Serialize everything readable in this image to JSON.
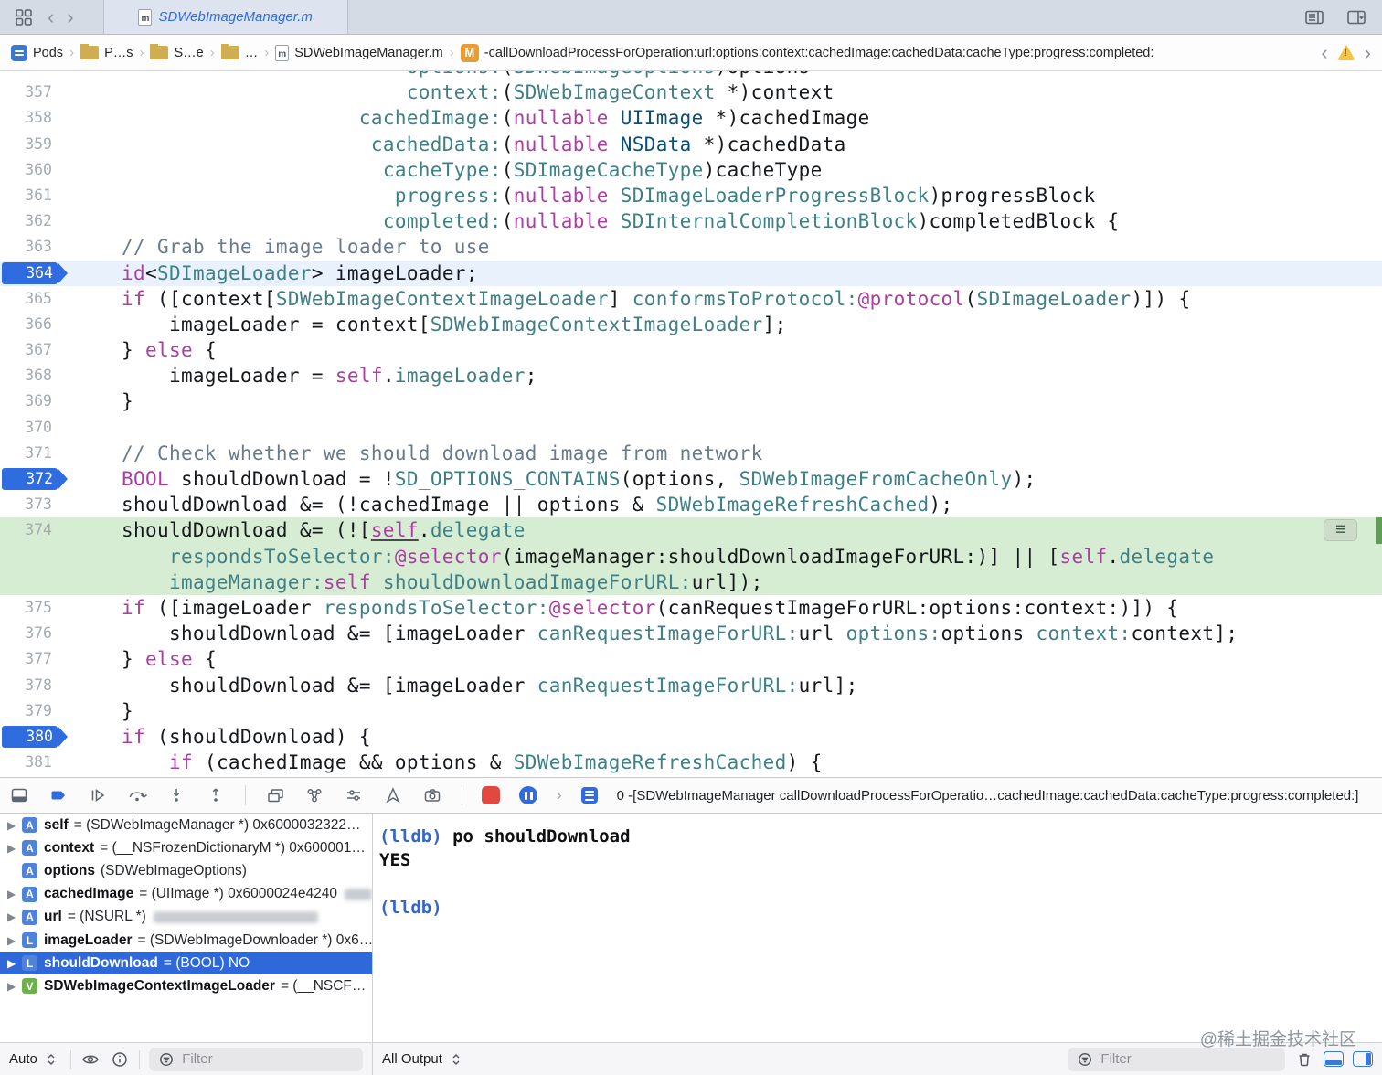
{
  "window": {
    "tab_title": "SDWebImageManager.m"
  },
  "jumpbar": {
    "items": [
      "Pods",
      "P…s",
      "S…e",
      "…",
      "SDWebImageManager.m"
    ],
    "method": "-callDownloadProcessForOperation:url:options:context:cachedImage:cachedData:cacheType:progress:completed:"
  },
  "colors": {
    "breakpoint_blue": "#2e6ce0",
    "selection_blue": "#2f68d8",
    "exec_green_bg": "#d7edd3",
    "keyword_pink": "#ad3da4",
    "project_teal": "#3e8087",
    "system_blue": "#0b4f79",
    "comment_gray": "#697b8a"
  },
  "icons": {
    "tabbar": [
      "tab-overview-icon",
      "back-chevron-icon",
      "forward-chevron-icon",
      "objc-file-icon",
      "editor-options-icon",
      "add-editor-icon"
    ],
    "jumpbar": [
      "project-icon",
      "folder-icon",
      "objc-file-icon",
      "method-badge-icon",
      "back-chevron-icon",
      "warning-icon",
      "forward-chevron-icon"
    ],
    "debugbar": [
      "hide-debug-area-icon",
      "breakpoints-toggle-icon",
      "continue-icon",
      "step-over-icon",
      "step-into-icon",
      "step-out-icon",
      "view-hierarchy-icon",
      "memory-graph-icon",
      "environment-overrides-icon",
      "simulate-location-icon",
      "metal-capture-icon",
      "app-icon",
      "paused-thread-icon",
      "stack-frame-icon"
    ],
    "bottombar": [
      "scope-chevrons-icon",
      "quicklook-eye-icon",
      "info-icon",
      "filter-icon",
      "trash-icon",
      "dock-bottom-icon",
      "dock-right-icon"
    ]
  },
  "editor": {
    "lines": [
      {
        "n": "",
        "k": "",
        "s": [
          [
            "p",
            "                            "
          ],
          [
            "t",
            "options:"
          ],
          [
            "p",
            "("
          ],
          [
            "t",
            "SDWebImageOptions"
          ],
          [
            "p",
            ")options"
          ]
        ]
      },
      {
        "n": "357",
        "k": "",
        "s": [
          [
            "p",
            "                            "
          ],
          [
            "t",
            "context:"
          ],
          [
            "p",
            "("
          ],
          [
            "t",
            "SDWebImageContext"
          ],
          [
            "p",
            " *)context"
          ]
        ]
      },
      {
        "n": "358",
        "k": "",
        "s": [
          [
            "p",
            "                        "
          ],
          [
            "t",
            "cachedImage:"
          ],
          [
            "p",
            "("
          ],
          [
            "k",
            "nullable"
          ],
          [
            "p",
            " "
          ],
          [
            "s",
            "UIImage"
          ],
          [
            "p",
            " *)cachedImage"
          ]
        ]
      },
      {
        "n": "359",
        "k": "",
        "s": [
          [
            "p",
            "                         "
          ],
          [
            "t",
            "cachedData:"
          ],
          [
            "p",
            "("
          ],
          [
            "k",
            "nullable"
          ],
          [
            "p",
            " "
          ],
          [
            "s",
            "NSData"
          ],
          [
            "p",
            " *)cachedData"
          ]
        ]
      },
      {
        "n": "360",
        "k": "",
        "s": [
          [
            "p",
            "                          "
          ],
          [
            "t",
            "cacheType:"
          ],
          [
            "p",
            "("
          ],
          [
            "t",
            "SDImageCacheType"
          ],
          [
            "p",
            ")cacheType"
          ]
        ]
      },
      {
        "n": "361",
        "k": "",
        "s": [
          [
            "p",
            "                           "
          ],
          [
            "t",
            "progress:"
          ],
          [
            "p",
            "("
          ],
          [
            "k",
            "nullable"
          ],
          [
            "p",
            " "
          ],
          [
            "t",
            "SDImageLoaderProgressBlock"
          ],
          [
            "p",
            ")progressBlock"
          ]
        ]
      },
      {
        "n": "362",
        "k": "",
        "s": [
          [
            "p",
            "                          "
          ],
          [
            "t",
            "completed:"
          ],
          [
            "p",
            "("
          ],
          [
            "k",
            "nullable"
          ],
          [
            "p",
            " "
          ],
          [
            "t",
            "SDInternalCompletionBlock"
          ],
          [
            "p",
            ")completedBlock {"
          ]
        ]
      },
      {
        "n": "363",
        "k": "",
        "s": [
          [
            "p",
            "    "
          ],
          [
            "c",
            "// Grab the image loader to use"
          ]
        ]
      },
      {
        "n": "364",
        "k": "bp",
        "bg": "sel",
        "s": [
          [
            "p",
            "    "
          ],
          [
            "k",
            "id"
          ],
          [
            "p",
            "<"
          ],
          [
            "t",
            "SDImageLoader"
          ],
          [
            "p",
            "> imageLoader;"
          ]
        ]
      },
      {
        "n": "365",
        "k": "",
        "s": [
          [
            "p",
            "    "
          ],
          [
            "k",
            "if"
          ],
          [
            "p",
            " ([context["
          ],
          [
            "t",
            "SDWebImageContextImageLoader"
          ],
          [
            "p",
            "] "
          ],
          [
            "t",
            "conformsToProtocol:"
          ],
          [
            "k",
            "@protocol"
          ],
          [
            "p",
            "("
          ],
          [
            "t",
            "SDImageLoader"
          ],
          [
            "p",
            ")]) {"
          ]
        ]
      },
      {
        "n": "366",
        "k": "",
        "s": [
          [
            "p",
            "        imageLoader = context["
          ],
          [
            "t",
            "SDWebImageContextImageLoader"
          ],
          [
            "p",
            "];"
          ]
        ]
      },
      {
        "n": "367",
        "k": "",
        "s": [
          [
            "p",
            "    } "
          ],
          [
            "k",
            "else"
          ],
          [
            "p",
            " {"
          ]
        ]
      },
      {
        "n": "368",
        "k": "",
        "s": [
          [
            "p",
            "        imageLoader = "
          ],
          [
            "k",
            "self"
          ],
          [
            "p",
            "."
          ],
          [
            "t",
            "imageLoader"
          ],
          [
            "p",
            ";"
          ]
        ]
      },
      {
        "n": "369",
        "k": "",
        "s": [
          [
            "p",
            "    }"
          ]
        ]
      },
      {
        "n": "370",
        "k": "",
        "s": []
      },
      {
        "n": "371",
        "k": "",
        "s": [
          [
            "p",
            "    "
          ],
          [
            "c",
            "// Check whether we should download image from network"
          ]
        ]
      },
      {
        "n": "372",
        "k": "bp",
        "s": [
          [
            "p",
            "    "
          ],
          [
            "k",
            "BOOL"
          ],
          [
            "p",
            " shouldDownload = !"
          ],
          [
            "t",
            "SD_OPTIONS_CONTAINS"
          ],
          [
            "p",
            "(options, "
          ],
          [
            "t",
            "SDWebImageFromCacheOnly"
          ],
          [
            "p",
            ");"
          ]
        ]
      },
      {
        "n": "373",
        "k": "",
        "s": [
          [
            "p",
            "    shouldDownload &= (!cachedImage || options & "
          ],
          [
            "t",
            "SDWebImageRefreshCached"
          ],
          [
            "p",
            ");"
          ]
        ]
      },
      {
        "n": "374",
        "k": "exec",
        "tag": true,
        "s": [
          [
            "p",
            "    shouldDownload &= (!["
          ],
          [
            "u",
            "self"
          ],
          [
            "p",
            "."
          ],
          [
            "t",
            "delegate"
          ]
        ]
      },
      {
        "n": "",
        "k": "exec",
        "s": [
          [
            "p",
            "        "
          ],
          [
            "t",
            "respondsToSelector:"
          ],
          [
            "k",
            "@selector"
          ],
          [
            "p",
            "(imageManager:shouldDownloadImageForURL:)] || ["
          ],
          [
            "k",
            "self"
          ],
          [
            "p",
            "."
          ],
          [
            "t",
            "delegate"
          ]
        ]
      },
      {
        "n": "",
        "k": "exec",
        "s": [
          [
            "p",
            "        "
          ],
          [
            "t",
            "imageManager:"
          ],
          [
            "k",
            "self"
          ],
          [
            "p",
            " "
          ],
          [
            "t",
            "shouldDownloadImageForURL:"
          ],
          [
            "p",
            "url]);"
          ]
        ]
      },
      {
        "n": "375",
        "k": "",
        "s": [
          [
            "p",
            "    "
          ],
          [
            "k",
            "if"
          ],
          [
            "p",
            " ([imageLoader "
          ],
          [
            "t",
            "respondsToSelector:"
          ],
          [
            "k",
            "@selector"
          ],
          [
            "p",
            "(canRequestImageForURL:options:context:)]) {"
          ]
        ]
      },
      {
        "n": "376",
        "k": "",
        "s": [
          [
            "p",
            "        shouldDownload &= [imageLoader "
          ],
          [
            "t",
            "canRequestImageForURL:"
          ],
          [
            "p",
            "url "
          ],
          [
            "t",
            "options:"
          ],
          [
            "p",
            "options "
          ],
          [
            "t",
            "context:"
          ],
          [
            "p",
            "context];"
          ]
        ]
      },
      {
        "n": "377",
        "k": "",
        "s": [
          [
            "p",
            "    } "
          ],
          [
            "k",
            "else"
          ],
          [
            "p",
            " {"
          ]
        ]
      },
      {
        "n": "378",
        "k": "",
        "s": [
          [
            "p",
            "        shouldDownload &= [imageLoader "
          ],
          [
            "t",
            "canRequestImageForURL:"
          ],
          [
            "p",
            "url];"
          ]
        ]
      },
      {
        "n": "379",
        "k": "",
        "s": [
          [
            "p",
            "    }"
          ]
        ]
      },
      {
        "n": "380",
        "k": "bp",
        "s": [
          [
            "p",
            "    "
          ],
          [
            "k",
            "if"
          ],
          [
            "p",
            " (shouldDownload) {"
          ]
        ]
      },
      {
        "n": "381",
        "k": "",
        "s": [
          [
            "p",
            "        "
          ],
          [
            "k",
            "if"
          ],
          [
            "p",
            " (cachedImage && options & "
          ],
          [
            "t",
            "SDWebImageRefreshCached"
          ],
          [
            "p",
            ") {"
          ]
        ]
      }
    ]
  },
  "debugbar": {
    "frame": "0 -[SDWebImageManager callDownloadProcessForOperatio…cachedImage:cachedData:cacheType:progress:completed:]"
  },
  "variables": [
    {
      "badge": "A",
      "name": "self",
      "value": "= (SDWebImageManager *) 0x6000032322…",
      "disclosure": true
    },
    {
      "badge": "A",
      "name": "context",
      "value": "= (__NSFrozenDictionaryM *) 0x600001…",
      "disclosure": true
    },
    {
      "badge": "A",
      "name": "options",
      "value": "(SDWebImageOptions)",
      "disclosure": false
    },
    {
      "badge": "A",
      "name": "cachedImage",
      "value": "= (UIImage *) 0x6000024e4240",
      "disclosure": true,
      "redacted": "sm-sm"
    },
    {
      "badge": "A",
      "name": "url",
      "value": "= (NSURL *)",
      "disclosure": true,
      "redacted": "sm-lg"
    },
    {
      "badge": "L",
      "name": "imageLoader",
      "value": "= (SDWebImageDownloader *) 0x6…",
      "disclosure": true
    },
    {
      "badge": "L",
      "name": "shouldDownload",
      "value": "= (BOOL) NO",
      "disclosure": true,
      "selected": true
    },
    {
      "badge": "V",
      "name": "SDWebImageContextImageLoader",
      "value": "= (__NSCF…",
      "disclosure": true
    }
  ],
  "console": {
    "prompt1": "(lldb)",
    "command": "po shouldDownload",
    "output": "YES",
    "prompt2": "(lldb)"
  },
  "bottom": {
    "left_scope": "Auto",
    "right_scope": "All Output",
    "filter_placeholder": "Filter"
  },
  "watermark": "@稀土掘金技术社区"
}
